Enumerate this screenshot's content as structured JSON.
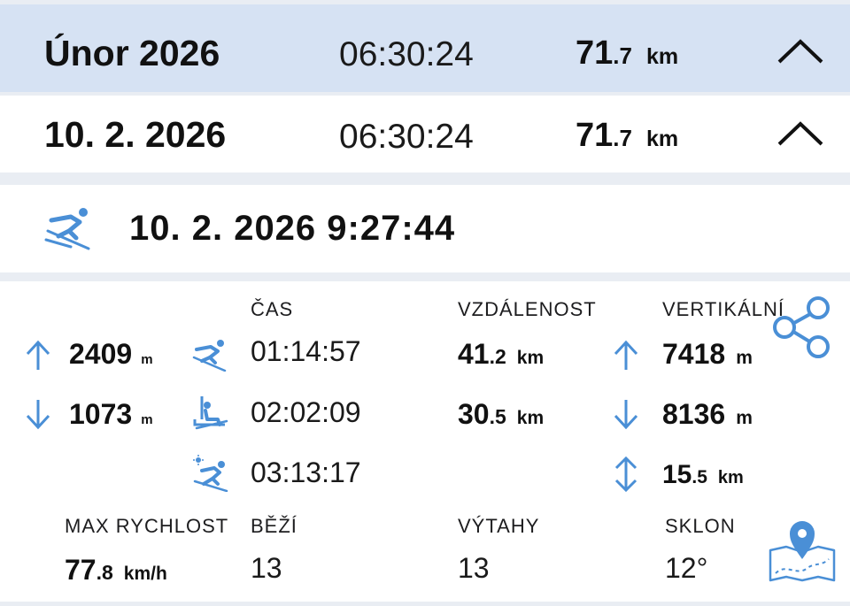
{
  "month_row": {
    "title": "Únor 2026",
    "time": "06:30:24",
    "distance_int": "71",
    "distance_dec": ".7",
    "distance_unit": "km",
    "icon": "chevron-up-icon"
  },
  "day_row": {
    "title": "10. 2. 2026",
    "time": "06:30:24",
    "distance_int": "71",
    "distance_dec": ".7",
    "distance_unit": "km",
    "icon": "chevron-up-icon"
  },
  "session": {
    "title": "10. 2. 2026 9:27:44",
    "icon": "skiing-icon"
  },
  "stats": {
    "headers": {
      "time": "ČAS",
      "distance": "VZDÁLENOST",
      "vertical": "VERTIKÁLNÍ"
    },
    "altitude": {
      "max": {
        "value": "2409",
        "unit": "m",
        "icon": "arrow-up-icon"
      },
      "min": {
        "value": "1073",
        "unit": "m",
        "icon": "arrow-down-icon"
      }
    },
    "times": {
      "ski": {
        "value": "01:14:57",
        "icon": "skier-icon"
      },
      "lift": {
        "value": "02:02:09",
        "icon": "chairlift-icon"
      },
      "total": {
        "value": "03:13:17",
        "icon": "skier-sun-icon"
      }
    },
    "distances": {
      "ski": {
        "int": "41",
        "dec": ".2",
        "unit": "km"
      },
      "lift": {
        "int": "30",
        "dec": ".5",
        "unit": "km"
      }
    },
    "vertical": {
      "down": {
        "value": "7418",
        "unit": "m",
        "icon": "arrow-up-icon"
      },
      "up": {
        "value": "8136",
        "unit": "m",
        "icon": "arrow-down-icon"
      },
      "total": {
        "int": "15",
        "dec": ".5",
        "unit": "km",
        "icon": "arrow-updown-icon"
      }
    },
    "bottom": {
      "max_speed_label": "MAX RYCHLOST",
      "max_speed_int": "77",
      "max_speed_dec": ".8",
      "max_speed_unit": "km/h",
      "runs_label": "BĚŽÍ",
      "runs_value": "13",
      "lifts_label": "VÝTAHY",
      "lifts_value": "13",
      "slope_label": "SKLON",
      "slope_value": "12°"
    }
  },
  "colors": {
    "accent": "#4a8fd6",
    "month_bg": "#d6e2f3",
    "page_bg": "#e9edf3"
  }
}
